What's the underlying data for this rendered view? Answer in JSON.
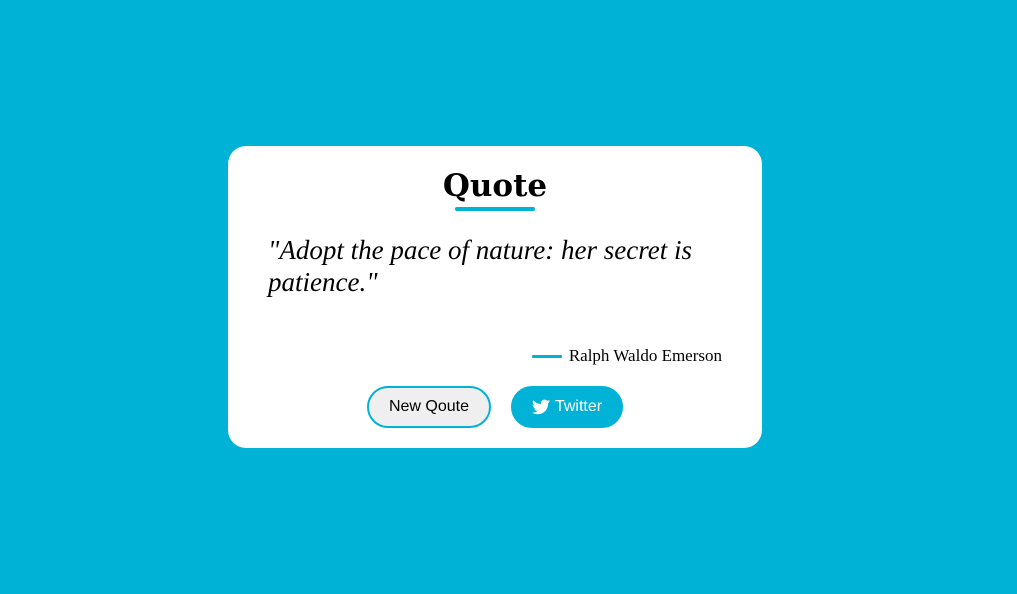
{
  "card": {
    "title": "Quote",
    "quote": "\"Adopt the pace of nature: her secret is patience.\"",
    "author": "Ralph Waldo Emerson"
  },
  "buttons": {
    "new_quote_label": "New Qoute",
    "twitter_label": "Twitter",
    "twitter_icon": "twitter-bird-icon"
  },
  "colors": {
    "background": "#00b2d6",
    "accent": "#00b2d6",
    "card": "#ffffff"
  }
}
